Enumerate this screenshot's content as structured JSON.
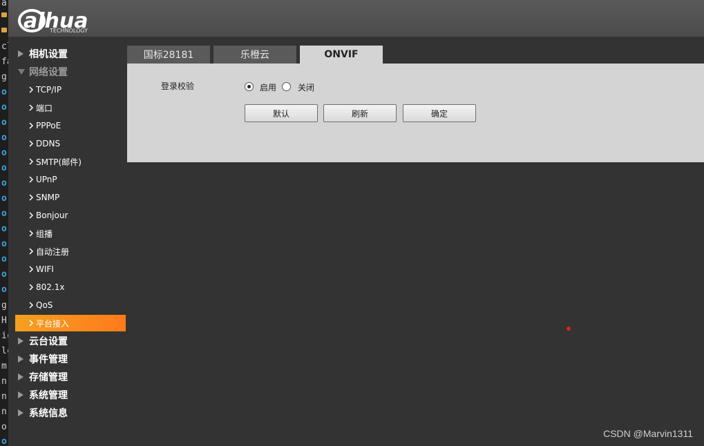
{
  "header": {
    "brand": "alhua",
    "brand_sub": "TECHNOLOGY"
  },
  "sidebar": {
    "items": [
      {
        "label": "相机设置",
        "level": "top",
        "state": "collapsed"
      },
      {
        "label": "网络设置",
        "level": "top",
        "state": "expanded"
      },
      {
        "label": "TCP/IP",
        "level": "sub"
      },
      {
        "label": "端口",
        "level": "sub"
      },
      {
        "label": "PPPoE",
        "level": "sub"
      },
      {
        "label": "DDNS",
        "level": "sub"
      },
      {
        "label": "SMTP(邮件)",
        "level": "sub"
      },
      {
        "label": "UPnP",
        "level": "sub"
      },
      {
        "label": "SNMP",
        "level": "sub"
      },
      {
        "label": "Bonjour",
        "level": "sub"
      },
      {
        "label": "组播",
        "level": "sub"
      },
      {
        "label": "自动注册",
        "level": "sub"
      },
      {
        "label": "WIFI",
        "level": "sub"
      },
      {
        "label": "802.1x",
        "level": "sub"
      },
      {
        "label": "QoS",
        "level": "sub"
      },
      {
        "label": "平台接入",
        "level": "sub",
        "state": "active"
      },
      {
        "label": "云台设置",
        "level": "top",
        "state": "collapsed"
      },
      {
        "label": "事件管理",
        "level": "top",
        "state": "collapsed"
      },
      {
        "label": "存储管理",
        "level": "top",
        "state": "collapsed"
      },
      {
        "label": "系统管理",
        "level": "top",
        "state": "collapsed"
      },
      {
        "label": "系统信息",
        "level": "top",
        "state": "collapsed"
      }
    ]
  },
  "tabs": [
    {
      "label": "国标28181"
    },
    {
      "label": "乐橙云"
    },
    {
      "label": "ONVIF",
      "active": true
    }
  ],
  "form": {
    "login_check_label": "登录校验",
    "enable_label": "启用",
    "disable_label": "关闭",
    "selected": "enable"
  },
  "buttons": {
    "default": "默认",
    "refresh": "刷新",
    "confirm": "确定"
  },
  "editor_strip": [
    "a",
    "cl",
    "fa",
    "g",
    "g",
    "H",
    "ic",
    "lc",
    "m",
    "n",
    "n",
    "n",
    "o"
  ],
  "watermark": "CSDN @Marvin1311",
  "colors": {
    "accent_active": "#f5a020",
    "panel_bg": "#d4d4d4",
    "page_bg": "#333333"
  }
}
